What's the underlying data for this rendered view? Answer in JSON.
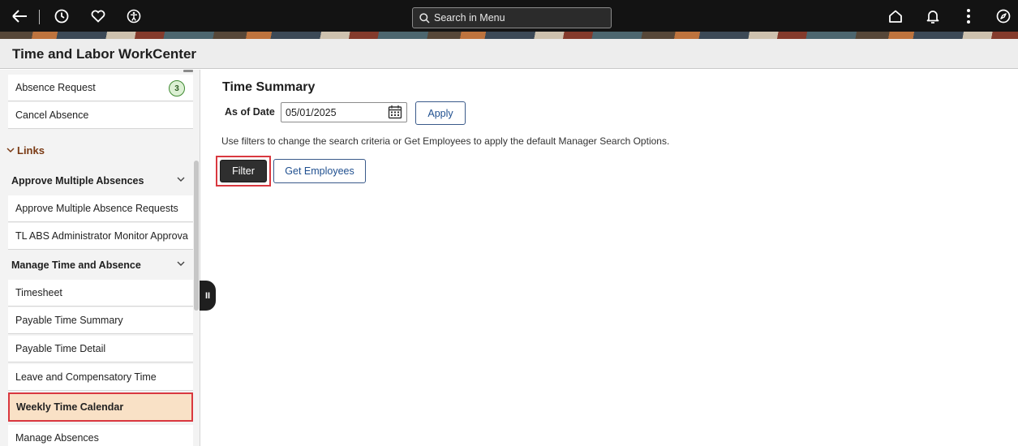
{
  "topbar": {
    "icons": [
      "back-arrow-icon",
      "history-icon",
      "favorites-heart-icon",
      "accessibility-icon",
      "home-icon",
      "notifications-bell-icon",
      "more-actions-icon",
      "navbar-compass-icon"
    ],
    "search_placeholder": "Search in Menu"
  },
  "titlebar": {
    "title": "Time and Labor WorkCenter"
  },
  "sidebar": {
    "items_top": [
      {
        "label": "Absence Request",
        "badge": "3"
      },
      {
        "label": "Cancel Absence"
      }
    ],
    "links_header": "Links",
    "groups": [
      {
        "label": "Approve Multiple Absences",
        "items": [
          "Approve Multiple Absence Requests",
          "TL ABS Administrator Monitor Approva"
        ]
      },
      {
        "label": "Manage Time and Absence",
        "items": [
          "Timesheet",
          "Payable Time Summary",
          "Payable Time Detail",
          "Leave and Compensatory Time",
          "Weekly Time Calendar",
          "Manage Absences"
        ]
      }
    ],
    "selected_item": "Weekly Time Calendar",
    "collapse_handle_glyph": "II"
  },
  "main": {
    "title": "Time Summary",
    "as_of_label": "As of Date",
    "as_of_value": "05/01/2025",
    "apply_label": "Apply",
    "hint": "Use filters to change the search criteria or Get Employees to apply the default Manager Search Options.",
    "filter_label": "Filter",
    "get_employees_label": "Get Employees"
  },
  "colors": {
    "topbar_bg": "#131313",
    "highlight_border": "#d9383f",
    "selected_bg": "#f9e1c6",
    "links_header": "#7a3a14",
    "button_text": "#1f4f8f"
  }
}
